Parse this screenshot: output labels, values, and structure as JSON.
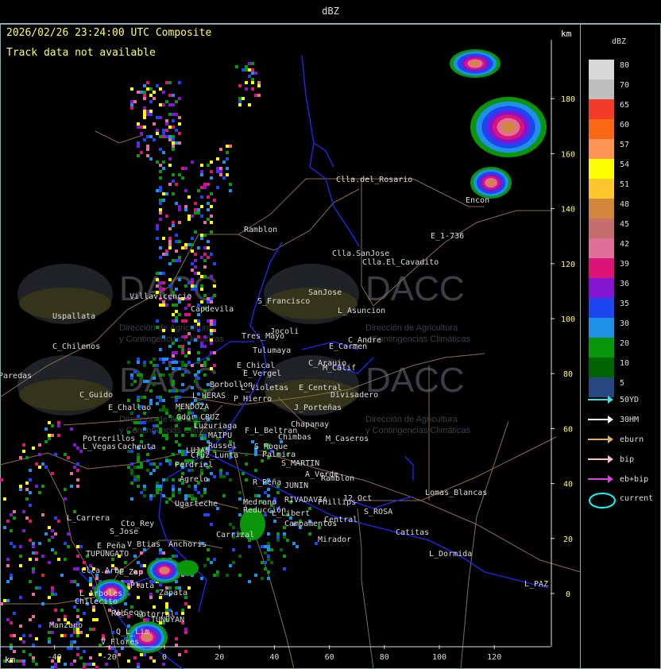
{
  "window": {
    "title": "dBZ"
  },
  "header": {
    "timestamp": "2026/02/26 23:24:00 UTC Composite",
    "track_status": "Track data not available",
    "km_top": "km",
    "km_bottom": "km"
  },
  "legend": {
    "title": "dBZ",
    "scale": [
      {
        "value": "80",
        "color": "#d8d8d8"
      },
      {
        "value": "70",
        "color": "#bebebe"
      },
      {
        "value": "65",
        "color": "#f23c28"
      },
      {
        "value": "60",
        "color": "#f96814"
      },
      {
        "value": "57",
        "color": "#fb9454"
      },
      {
        "value": "54",
        "color": "#ffff00"
      },
      {
        "value": "51",
        "color": "#fcc62c"
      },
      {
        "value": "48",
        "color": "#d2873c"
      },
      {
        "value": "45",
        "color": "#c46e6e"
      },
      {
        "value": "42",
        "color": "#e0709a"
      },
      {
        "value": "39",
        "color": "#dc1478"
      },
      {
        "value": "36",
        "color": "#8214d2"
      },
      {
        "value": "35",
        "color": "#1e46f0"
      },
      {
        "value": "30",
        "color": "#1e90e6"
      },
      {
        "value": "20",
        "color": "#0a960a"
      },
      {
        "value": "10",
        "color": "#006400"
      },
      {
        "value": "5",
        "color": "#284680"
      }
    ],
    "tracks": [
      {
        "label": "50YD",
        "color": "#40e0e0"
      },
      {
        "label": "30HM",
        "color": "#ffffff"
      },
      {
        "label": "eburn",
        "color": "#e0b070"
      },
      {
        "label": "bip",
        "color": "#ffc0cb"
      },
      {
        "label": "eb+bip",
        "color": "#e040e0"
      }
    ],
    "current_label": "current"
  },
  "axes": {
    "x_ticks": [
      "-40",
      "-20",
      "0",
      "20",
      "40",
      "60",
      "80",
      "100",
      "120"
    ],
    "y_ticks": [
      "180",
      "160",
      "140",
      "120",
      "100",
      "80",
      "60",
      "40",
      "20",
      "0"
    ]
  },
  "watermark": {
    "brand": "DACC",
    "line1": "Dirección de Agricultura",
    "line2": "y Contingencias Climáticas"
  },
  "places": [
    "Clla.del_Rosario",
    "Ramblon",
    "Encon",
    "E_1-736",
    "Clla.SanJose",
    "Clla.El_Cavadito",
    "Villavicencio",
    "Capdevila",
    "S_Francisco",
    "SanJose",
    "L_Asuncion",
    "Uspallata",
    "Tres_Mayo",
    "Jocoli",
    "C_Andre",
    "E_Carmen",
    "C_Chilenos",
    "Tulumaya",
    "C_Arauio",
    "E_Chical",
    "M_Calif",
    "E_Vergel",
    "Borbollon",
    "Paredas",
    "L_Violetas",
    "E_Central",
    "Divisadero",
    "C_Guido",
    "E_Challao",
    "L_HERAS",
    "P_Hierro",
    "MENDOZA",
    "J_Porteñas",
    "Gdor_CRUZ",
    "Luzuriaga",
    "F_L_Beltran",
    "Chapanay",
    "MAIPU",
    "Chimbas",
    "M_Caseros",
    "Potrerillos",
    "Russel",
    "S_Roque",
    "L_Vegas",
    "Cacheuta",
    "LUJAN",
    "Cruz_Lunta",
    "Palmira",
    "Perdriel",
    "S_MARTIN",
    "A_Verde",
    "Ramblon",
    "Agrelo",
    "R_Peña",
    "JUNIN",
    "RIVADAVIA",
    "12_Oct",
    "Lomas_Blancas",
    "Phillips",
    "Ugarteche",
    "Medrano",
    "Reducción",
    "S_ROSA",
    "L_Carrera",
    "Cto_Rey",
    "L_Libert",
    "Central",
    "S_Jose",
    "Campamentos",
    "Catitas",
    "E_Peña",
    "V_Btias",
    "Anchoris",
    "Carrizal",
    "Mirador",
    "TUPUNGATO",
    "L_Dormida",
    "Clla.Arbo",
    "E_Zap",
    "L_Arboles",
    "Zapata",
    "L_PAZ",
    "Chilecito",
    "Plata",
    "Rob",
    "V_Seca",
    "Lotorral",
    "TUNUYAN",
    "Manzano",
    "Q_L_Lim",
    "V_Flores"
  ]
}
